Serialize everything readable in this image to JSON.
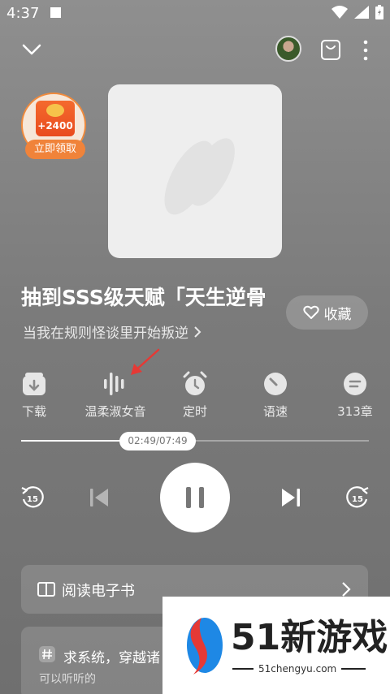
{
  "status": {
    "time": "4:37"
  },
  "reward": {
    "amount": "+2400",
    "button": "立即领取"
  },
  "book": {
    "title": "抽到SSS级天赋「天生逆骨",
    "subtitle": "当我在规则怪谈里开始叛逆",
    "favorite_label": "收藏"
  },
  "tools": [
    {
      "label": "下载",
      "icon": "download-icon"
    },
    {
      "label": "温柔淑女音",
      "icon": "voice-wave-icon"
    },
    {
      "label": "定时",
      "icon": "alarm-clock-icon"
    },
    {
      "label": "语速",
      "icon": "speed-gauge-icon"
    },
    {
      "label": "313章",
      "icon": "chapters-icon"
    }
  ],
  "player": {
    "time": "02:49/07:49",
    "progress": 0.3,
    "rewind_seconds": "15",
    "forward_seconds": "15"
  },
  "ebook": {
    "label": "阅读电子书"
  },
  "card2": {
    "title": "求系统，穿越诸",
    "subtitle": "可以听听的"
  },
  "watermark": {
    "text": "51新游戏",
    "url": "51chengyu.com"
  },
  "colors": {
    "accent": "#f0833a",
    "red": "#e53935",
    "bg": "#7f7f7f"
  }
}
